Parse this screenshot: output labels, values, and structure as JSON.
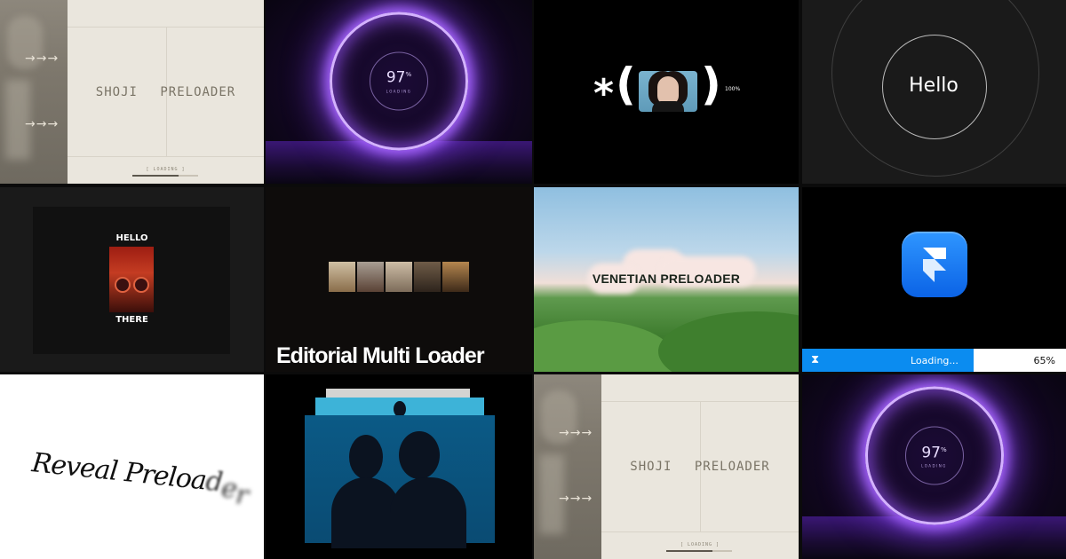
{
  "tiles": {
    "shoji": {
      "title": "SHOJI PRELOADER",
      "loading": "[ LOADING ]",
      "arrow": "→→→",
      "progress": 0.7
    },
    "portal": {
      "percent": "97",
      "percent_sign": "%",
      "label": "LOADING"
    },
    "parens": {
      "star": "*",
      "left_paren": "(",
      "right_paren": ")",
      "percent": "100%"
    },
    "hello": {
      "word": "Hello"
    },
    "hello_there": {
      "top": "HELLO",
      "bottom": "THERE"
    },
    "editorial": {
      "caption": "Editorial Multi Loader"
    },
    "venetian": {
      "title": "VENETIAN PRELOADER"
    },
    "framer": {
      "status": "Loading...",
      "percent": "65%",
      "progress": 0.65,
      "accent": "#0b8cf0"
    },
    "reveal": {
      "word_main": "Reveal Preloa",
      "tail1": "d",
      "tail2": "e",
      "tail3": "r"
    }
  }
}
